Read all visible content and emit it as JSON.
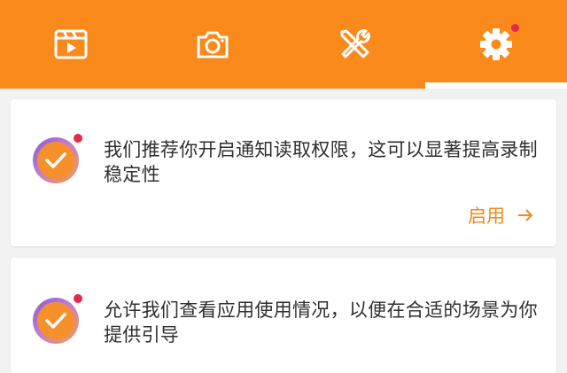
{
  "tabs": [
    {
      "icon": "video-icon",
      "label": ""
    },
    {
      "icon": "camera-icon",
      "label": ""
    },
    {
      "icon": "tools-icon",
      "label": ""
    },
    {
      "icon": "gear-icon",
      "label": ""
    }
  ],
  "active_tab": 3,
  "colors": {
    "accent": "#fb8a1d",
    "notification_dot": "#e5294a",
    "action_text": "#f08a1c",
    "background": "#f2f2f2"
  },
  "cards": [
    {
      "icon": "check-badge-icon",
      "message": "我们推荐你开启通知读取权限，这可以显著提高录制稳定性",
      "action_label": "启用"
    },
    {
      "icon": "check-badge-icon",
      "message": "允许我们查看应用使用情况，以便在合适的场景为你提供引导",
      "action_label": ""
    }
  ]
}
